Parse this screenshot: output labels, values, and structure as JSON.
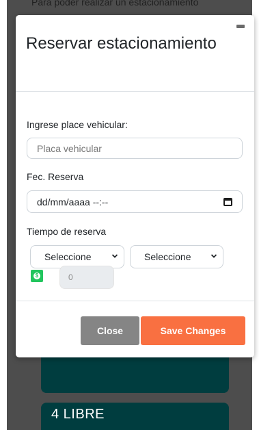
{
  "background": {
    "top_text": "Para poder realizar un estacionamiento",
    "card_label": "4 LIBRE",
    "card_color": "#003d3f"
  },
  "modal": {
    "title": "Reservar estacionamiento",
    "close_icon": "minimize-icon",
    "plate": {
      "label": "Ingrese place vehicular:",
      "placeholder": "Placa vehicular",
      "value": ""
    },
    "date": {
      "label": "Fec. Reserva",
      "value": "dd/mm/aaaa --:--",
      "icon": "calendar-icon"
    },
    "duration": {
      "label": "Tiempo de reserva",
      "select_1": "Seleccione",
      "select_2": "Seleccione"
    },
    "price": {
      "icon": "money-icon",
      "icon_glyph": "$",
      "value": "0",
      "icon_color": "#22c55e"
    },
    "footer": {
      "close_label": "Close",
      "save_label": "Save Changes",
      "save_color": "#f97041"
    }
  }
}
